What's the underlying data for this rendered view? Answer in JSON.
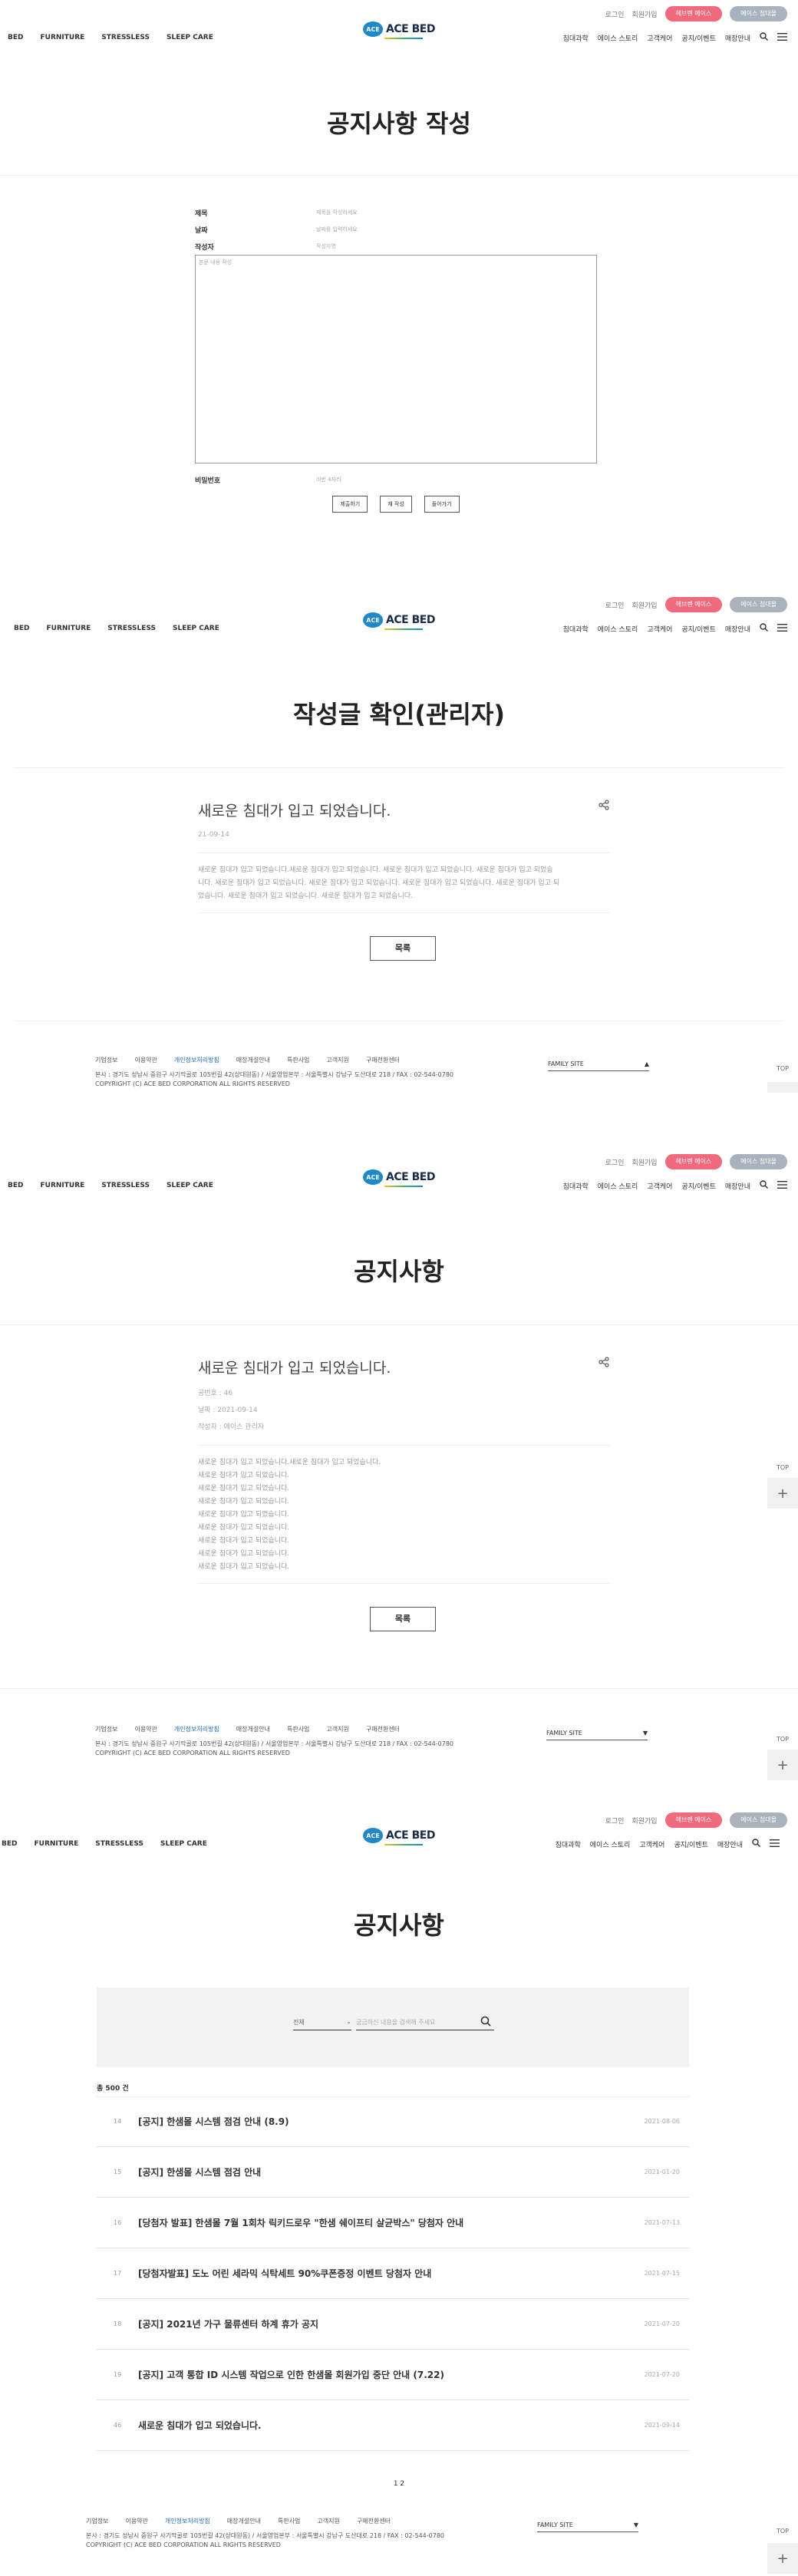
{
  "header": {
    "login": "로그인",
    "join": "회원가입",
    "pill_pink": "헤브렌 에이스",
    "pill_gray": "에이스 침대몰",
    "nav_left": [
      "BED",
      "FURNITURE",
      "STRESSLESS",
      "SLEEP CARE"
    ],
    "nav_right": [
      "침대과학",
      "에이스 스토리",
      "고객케어",
      "공지/이벤트",
      "매장안내"
    ],
    "logo_badge": "ACE",
    "logo_text": "ACE BED"
  },
  "write": {
    "title": "공지사항 작성",
    "subject_label": "제목",
    "subject_ph": "제목을 작성하세요",
    "date_label": "날짜",
    "date_ph": "날짜를 입력하세요",
    "author_label": "작성자",
    "author_ph": "작성자명",
    "body_ph": "본문 내용 작성",
    "password_label": "비밀번호",
    "password_ph": "비번 4자리",
    "btn_submit": "제출하기",
    "btn_reset": "재 작성",
    "btn_back": "돌아가기"
  },
  "confirm": {
    "title": "작성글 확인(관리자)",
    "post_title": "새로운 침대가 입고 되었습니다.",
    "post_date": "21-09-14",
    "post_body": [
      "새로운 침대가 입고 되었습니다.새로운 침대가 입고 되었습니다. 새로운 침대가 입고 되었습니다. 새로운 침대가 입고 되었습",
      "니다. 새로운 침대가 입고 되었습니다. 새로운 침대가 입고 되었습니다. 새로운 침대가 입고 되었습니다. 새로운 침대가 입고 되",
      "었습니다. 새로운 침대가 입고 되었습니다. 새로운 침대가 입고 되었습니다."
    ],
    "list_btn": "목록"
  },
  "detail": {
    "title": "공지사항",
    "post_title": "새로운 침대가 입고 되었습니다.",
    "meta_no": "공번호 : 46",
    "meta_date": "날짜 : 2021-09-14",
    "meta_author": "작성자 : 에이스 관리자",
    "body_lines": [
      "새로운 침대가 입고 되었습니다.새로운 침대가 입고 되었습니다.",
      "새로운 침대가 입고 되었습니다.",
      "새로운 침대가 입고 되었습니다.",
      "새로운 침대가 입고 되었습니다.",
      "새로운 침대가 입고 되었습니다.",
      "새로운 침대가 입고 되었습니다.",
      "새로운 침대가 입고 되었습니다.",
      "새로운 침대가 입고 되었습니다.",
      "새로운 침대가 입고 되었습니다."
    ],
    "list_btn": "목록"
  },
  "list": {
    "title": "공지사항",
    "select_value": "전체",
    "search_ph": "궁금하신 내용을 검색해 주세요",
    "total": "총 500 건",
    "rows": [
      {
        "num": "14",
        "title": "[공지] 한샘몰 시스템 점검 안내 (8.9)",
        "date": "2021-08-06"
      },
      {
        "num": "15",
        "title": "[공지] 한샘몰 시스템 점검 안내",
        "date": "2021-01-20"
      },
      {
        "num": "16",
        "title": "[당첨자 발표] 한샘몰 7월 1회차 릭키드로우 \"한샘 쉐이프티 살균박스\" 당첨자 안내",
        "date": "2021-07-13"
      },
      {
        "num": "17",
        "title": "[당첨자발표] 도노 어린 세라믹 식탁세트 90%쿠폰증정 이벤트 당첨자 안내",
        "date": "2021-07-15"
      },
      {
        "num": "18",
        "title": "[공지] 2021년 가구 물류센터 하계 휴가 공지",
        "date": "2021-07-20"
      },
      {
        "num": "19",
        "title": "[공지] 고객 통합 ID 시스템 작업으로 인한 한샘몰 회원가입 중단 안내 (7.22)",
        "date": "2021-07-20"
      },
      {
        "num": "46",
        "title": "새로운 침대가 입고 되었습니다.",
        "date": "2021-09-14"
      }
    ],
    "pagination": "1 2"
  },
  "footer": {
    "links": [
      "기업정보",
      "이용약관",
      "개인정보처리방침",
      "매장개설안내",
      "특판사업",
      "고객지원",
      "구매전환센터"
    ],
    "address": "본사 : 경기도 성남시 중원구 사기막골로 105번길 42(상대원동) / 서울영업본부 : 서울특별시 강남구 도산대로 218 / FAX : 02-544-0780",
    "copyright": "COPYRIGHT (C) ACE BED CORPORATION ALL RIGHTS RESERVED",
    "family_site": "FAMILY SITE",
    "top": "TOP"
  },
  "icons": {
    "search": "search-icon",
    "menu": "hamburger-icon",
    "share": "share-icon",
    "plus": "plus-icon"
  }
}
